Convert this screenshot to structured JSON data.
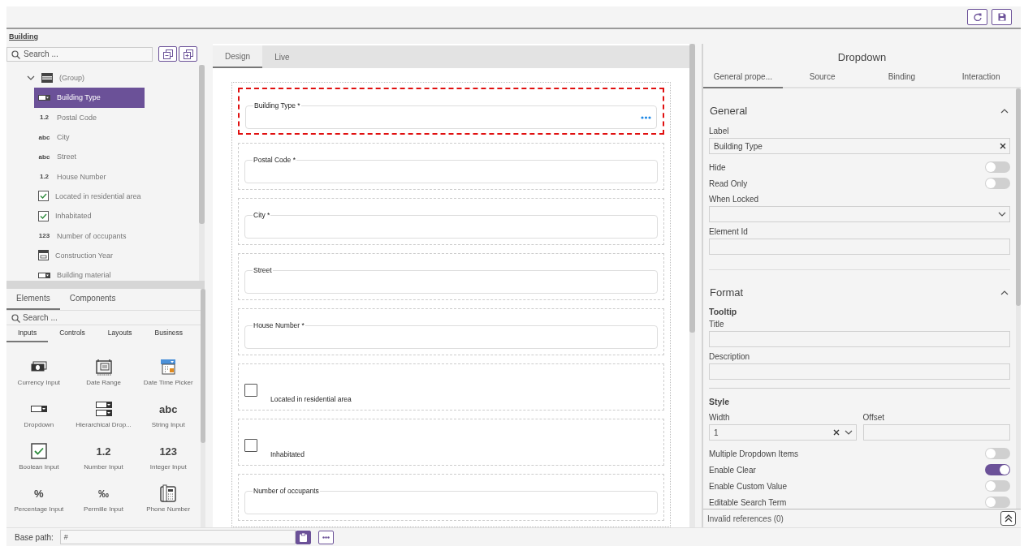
{
  "breadcrumb": "Building",
  "tree": {
    "search_placeholder": "Search ...",
    "items": [
      {
        "label": "(Group)",
        "kind": "group",
        "expanded": true,
        "selected": false,
        "children": [
          {
            "label": "Building Type",
            "kind": "dropdown",
            "selected": true
          },
          {
            "label": "Postal Code",
            "kind": "glyph",
            "glyph": "1.2",
            "selected": false
          },
          {
            "label": "City",
            "kind": "glyph",
            "glyph": "abc",
            "selected": false
          },
          {
            "label": "Street",
            "kind": "glyph",
            "glyph": "abc",
            "selected": false
          },
          {
            "label": "House Number",
            "kind": "glyph",
            "glyph": "1.2",
            "selected": false
          },
          {
            "label": "Located in residential area",
            "kind": "boolean",
            "selected": false
          },
          {
            "label": "Inhabitated",
            "kind": "boolean",
            "selected": false
          },
          {
            "label": "Number of occupants",
            "kind": "glyph",
            "glyph": "123",
            "selected": false
          },
          {
            "label": "Construction Year",
            "kind": "calendar",
            "selected": false
          },
          {
            "label": "Building material",
            "kind": "dropdown",
            "selected": false
          }
        ]
      }
    ]
  },
  "palette": {
    "tabs": [
      {
        "label": "Elements",
        "selected": true
      },
      {
        "label": "Components",
        "selected": false
      }
    ],
    "search_placeholder": "Search ...",
    "categories": [
      {
        "label": "Inputs",
        "selected": true
      },
      {
        "label": "Controls",
        "selected": false
      },
      {
        "label": "Layouts",
        "selected": false
      },
      {
        "label": "Business",
        "selected": false
      }
    ],
    "items": [
      {
        "label": "Currency Input",
        "kind": "currency"
      },
      {
        "label": "Date Range",
        "kind": "daterange"
      },
      {
        "label": "Date Time Picker",
        "kind": "datetime"
      },
      {
        "label": "Dropdown",
        "kind": "dropdown"
      },
      {
        "label": "Hierarchical Drop...",
        "kind": "hierarchical"
      },
      {
        "label": "String Input",
        "kind": "glyph",
        "glyph": "abc"
      },
      {
        "label": "Boolean Input",
        "kind": "boolean"
      },
      {
        "label": "Number Input",
        "kind": "glyph",
        "glyph": "1.2"
      },
      {
        "label": "Integer Input",
        "kind": "glyph",
        "glyph": "123"
      },
      {
        "label": "Percentage Input",
        "kind": "glyph",
        "glyph": "%"
      },
      {
        "label": "Permille Input",
        "kind": "glyph",
        "glyph": "‰"
      },
      {
        "label": "Phone Number",
        "kind": "phone"
      }
    ]
  },
  "designer": {
    "tabs": [
      {
        "label": "Design",
        "selected": true
      },
      {
        "label": "Live",
        "selected": false
      }
    ],
    "fields": [
      {
        "kind": "input",
        "label": "Building Type *",
        "selected": true
      },
      {
        "kind": "input",
        "label": "Postal Code *",
        "selected": false
      },
      {
        "kind": "input",
        "label": "City *",
        "selected": false
      },
      {
        "kind": "input",
        "label": "Street",
        "selected": false
      },
      {
        "kind": "input",
        "label": "House Number *",
        "selected": false
      },
      {
        "kind": "checkbox",
        "label": "Located in residential area",
        "checked": false,
        "selected": false
      },
      {
        "kind": "checkbox",
        "label": "Inhabitated",
        "checked": false,
        "selected": false
      },
      {
        "kind": "input",
        "label": "Number of occupants",
        "selected": false
      }
    ]
  },
  "properties": {
    "title": "Dropdown",
    "tabs": [
      {
        "label": "General prope...",
        "selected": true
      },
      {
        "label": "Source",
        "selected": false
      },
      {
        "label": "Binding",
        "selected": false
      },
      {
        "label": "Interaction",
        "selected": false
      }
    ],
    "sections": [
      {
        "title": "General",
        "expanded": true,
        "groups": [
          {
            "rows": [
              {
                "kind": "text",
                "label": "Label",
                "value": "Building Type",
                "clearable": true
              },
              {
                "kind": "toggle",
                "label": "Hide",
                "on": false
              },
              {
                "kind": "toggle",
                "label": "Read Only",
                "on": false
              },
              {
                "kind": "select",
                "label": "When Locked"
              },
              {
                "kind": "text",
                "label": "Element Id"
              }
            ]
          }
        ]
      },
      {
        "title": "Format",
        "expanded": true,
        "groups": [
          {
            "title": "Tooltip",
            "rows": [
              {
                "kind": "text",
                "label": "Title"
              },
              {
                "kind": "text",
                "label": "Description"
              }
            ]
          },
          {
            "title": "Style",
            "rows": [
              {
                "kind": "pair",
                "fields": [
                  {
                    "label": "Width",
                    "value": "1",
                    "clearable": true,
                    "dropdown": true
                  },
                  {
                    "label": "Offset"
                  }
                ]
              },
              {
                "kind": "toggle",
                "label": "Multiple Dropdown Items",
                "on": false
              },
              {
                "kind": "toggle",
                "label": "Enable Clear",
                "on": true
              },
              {
                "kind": "toggle",
                "label": "Enable Custom Value",
                "on": false
              },
              {
                "kind": "toggle",
                "label": "Editable Search Term",
                "on": false
              }
            ]
          }
        ]
      }
    ],
    "footer": "Invalid references (0)"
  },
  "bottom_bar": {
    "label": "Base path:",
    "value": "#"
  }
}
